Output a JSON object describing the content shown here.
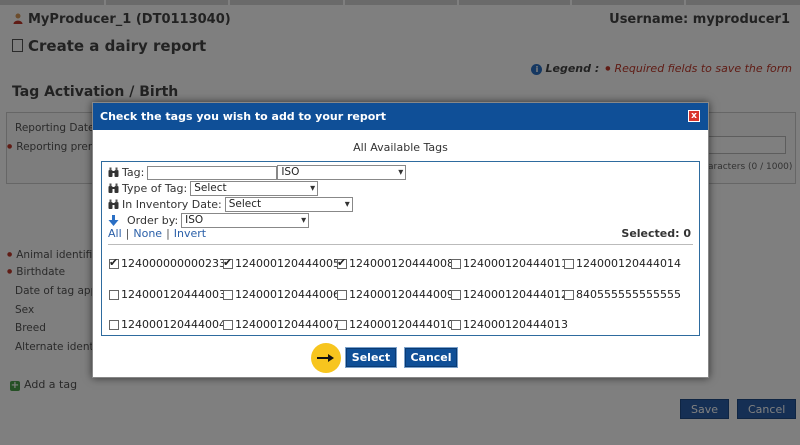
{
  "header": {
    "producer": "MyProducer_1 (DT0113040)",
    "username": "Username: myproducer1",
    "page_title": "Create a dairy report"
  },
  "legend": {
    "label": "Legend :",
    "required_text": "Required fields to save the form"
  },
  "section_title": "Tag Activation / Birth",
  "background_form": {
    "reporting_date": "Reporting Date",
    "reporting_premises": "Reporting prem",
    "characters": "aracters (0 / 1000)",
    "animal_id": "Animal identific",
    "birthdate": "Birthdate",
    "date_tag_applied": "Date of tag app",
    "sex": "Sex",
    "breed": "Breed",
    "alternate_id": "Alternate identi",
    "add_tag": "Add a tag",
    "save": "Save",
    "cancel": "Cancel"
  },
  "dialog": {
    "title": "Check the tags you wish to add to your report",
    "close_label": "x",
    "subtitle": "All Available Tags",
    "filters": {
      "tag_label": "Tag:",
      "tag_value": "",
      "tag_type_select": "ISO",
      "type_label": "Type of Tag:",
      "type_select": "Select",
      "inventory_label": "In Inventory Date:",
      "inventory_select": "Select",
      "order_label": "Order by:",
      "order_select": "ISO"
    },
    "links": {
      "all": "All",
      "none": "None",
      "invert": "Invert"
    },
    "selected_count": "Selected: 0",
    "tags": [
      {
        "id": "124000000000233",
        "checked": true
      },
      {
        "id": "124000120444005",
        "checked": true
      },
      {
        "id": "124000120444008",
        "checked": true
      },
      {
        "id": "124000120444011",
        "checked": false
      },
      {
        "id": "124000120444014",
        "checked": false
      },
      {
        "id": "124000120444003",
        "checked": false
      },
      {
        "id": "124000120444006",
        "checked": false
      },
      {
        "id": "124000120444009",
        "checked": false
      },
      {
        "id": "124000120444012",
        "checked": false
      },
      {
        "id": "840555555555555",
        "checked": false
      },
      {
        "id": "124000120444004",
        "checked": false
      },
      {
        "id": "124000120444007",
        "checked": false
      },
      {
        "id": "124000120444010",
        "checked": false
      },
      {
        "id": "124000120444013",
        "checked": false
      }
    ],
    "select_button": "Select",
    "cancel_button": "Cancel"
  }
}
